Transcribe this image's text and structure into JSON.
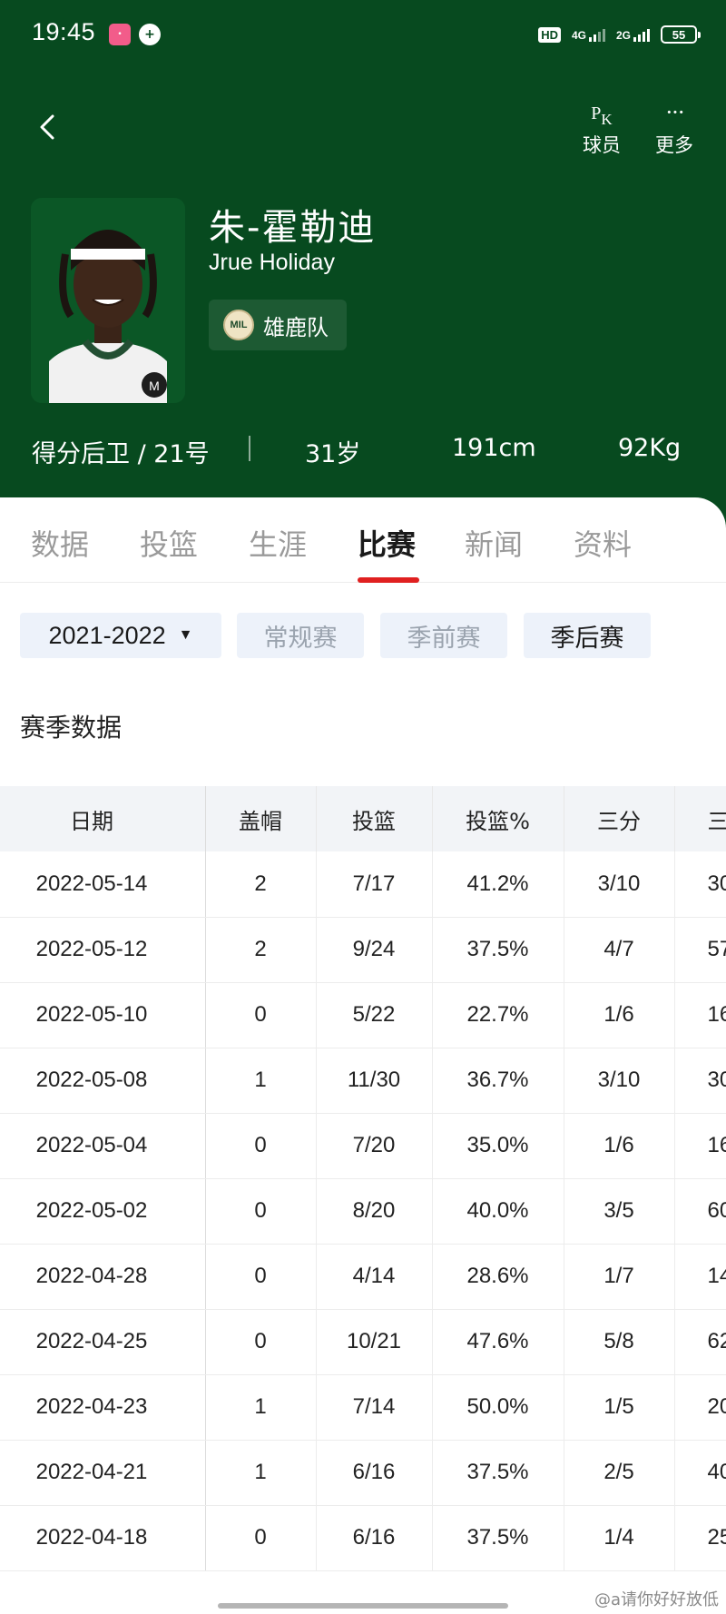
{
  "status_bar": {
    "time": "19:45",
    "network_1": "4G",
    "network_2": "2G",
    "hd_label": "HD",
    "battery": "55"
  },
  "header": {
    "actions": [
      {
        "icon": "pk-icon",
        "glyph": "PK",
        "label": "球员"
      },
      {
        "icon": "more-icon",
        "glyph": "···",
        "label": "更多"
      }
    ],
    "player": {
      "name_cn": "朱-霍勒迪",
      "name_en": "Jrue Holiday",
      "team_logo_text": "MIL",
      "team": "雄鹿队",
      "position_number": "得分后卫 / 21号",
      "age": "31岁",
      "height": "191cm",
      "weight": "92Kg"
    },
    "colors": {
      "primary": "#074a1f",
      "accent": "#e02020"
    }
  },
  "tabs": [
    {
      "label": "数据",
      "active": false
    },
    {
      "label": "投篮",
      "active": false
    },
    {
      "label": "生涯",
      "active": false
    },
    {
      "label": "比赛",
      "active": true
    },
    {
      "label": "新闻",
      "active": false
    },
    {
      "label": "资料",
      "active": false
    }
  ],
  "filters": {
    "season": "2021-2022",
    "types": [
      {
        "label": "常规赛",
        "selected": false
      },
      {
        "label": "季前赛",
        "selected": false
      },
      {
        "label": "季后赛",
        "selected": true
      }
    ]
  },
  "section_title": "赛季数据",
  "table": {
    "headers": [
      "日期",
      "盖帽",
      "投篮",
      "投篮%",
      "三分",
      "三"
    ],
    "rows": [
      [
        "2022-05-14",
        "2",
        "7/17",
        "41.2%",
        "3/10",
        "30"
      ],
      [
        "2022-05-12",
        "2",
        "9/24",
        "37.5%",
        "4/7",
        "57"
      ],
      [
        "2022-05-10",
        "0",
        "5/22",
        "22.7%",
        "1/6",
        "16"
      ],
      [
        "2022-05-08",
        "1",
        "11/30",
        "36.7%",
        "3/10",
        "30"
      ],
      [
        "2022-05-04",
        "0",
        "7/20",
        "35.0%",
        "1/6",
        "16"
      ],
      [
        "2022-05-02",
        "0",
        "8/20",
        "40.0%",
        "3/5",
        "60"
      ],
      [
        "2022-04-28",
        "0",
        "4/14",
        "28.6%",
        "1/7",
        "14"
      ],
      [
        "2022-04-25",
        "0",
        "10/21",
        "47.6%",
        "5/8",
        "62"
      ],
      [
        "2022-04-23",
        "1",
        "7/14",
        "50.0%",
        "1/5",
        "20"
      ],
      [
        "2022-04-21",
        "1",
        "6/16",
        "37.5%",
        "2/5",
        "40"
      ],
      [
        "2022-04-18",
        "0",
        "6/16",
        "37.5%",
        "1/4",
        "25"
      ]
    ]
  },
  "watermark": "@a请你好好放低"
}
